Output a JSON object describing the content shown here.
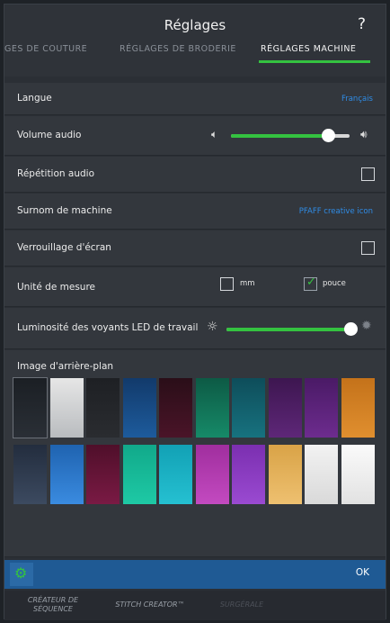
{
  "header": {
    "title": "Réglages",
    "help_icon": "?"
  },
  "tabs": [
    {
      "label": "GES DE COUTURE",
      "active": false
    },
    {
      "label": "RÉGLAGES DE BRODERIE",
      "active": false
    },
    {
      "label": "RÉGLAGES MACHINE",
      "active": true
    }
  ],
  "settings": {
    "language": {
      "label": "Langue",
      "value": "Français"
    },
    "volume": {
      "label": "Volume audio",
      "level": 0.82
    },
    "audio_repeat": {
      "label": "Répétition audio",
      "checked": false
    },
    "nickname": {
      "label": "Surnom de machine",
      "value": "PFAFF creative icon"
    },
    "screen_lock": {
      "label": "Verrouillage d'écran",
      "checked": false
    },
    "units": {
      "label": "Unité de mesure",
      "options": [
        {
          "label": "mm",
          "checked": false
        },
        {
          "label": "pouce",
          "checked": true
        }
      ]
    },
    "led_brightness": {
      "label": "Luminosité des voyants LED de travail",
      "level": 0.96
    },
    "background": {
      "label": "Image d'arrière-plan",
      "selected_index": 0,
      "swatches": [
        {
          "top": "#1b1f24",
          "bottom": "#2a2f36"
        },
        {
          "top": "#e6e6e6",
          "bottom": "#b9bcbf"
        },
        {
          "top": "#1e2024",
          "bottom": "#2a2c30"
        },
        {
          "top": "#123a6b",
          "bottom": "#1d5b9c"
        },
        {
          "top": "#2a0e18",
          "bottom": "#4a1428"
        },
        {
          "top": "#0d5a45",
          "bottom": "#168a68"
        },
        {
          "top": "#0e4d5a",
          "bottom": "#17727f"
        },
        {
          "top": "#3d1650",
          "bottom": "#5e2778"
        },
        {
          "top": "#4a1a66",
          "bottom": "#6d2c8e"
        },
        {
          "top": "#c4721a",
          "bottom": "#e08f2f"
        },
        {
          "top": "#232d3e",
          "bottom": "#3c4a60"
        },
        {
          "top": "#1f63b0",
          "bottom": "#3a8be0"
        },
        {
          "top": "#4f0f2a",
          "bottom": "#7a1a44"
        },
        {
          "top": "#11a98a",
          "bottom": "#1ec9a5"
        },
        {
          "top": "#12a1b5",
          "bottom": "#25c0d1"
        },
        {
          "top": "#a02e9e",
          "bottom": "#c34ac0"
        },
        {
          "top": "#7b2fb0",
          "bottom": "#9a4ad1"
        },
        {
          "top": "#d9a347",
          "bottom": "#eec070"
        },
        {
          "top": "#f2f2f2",
          "bottom": "#d9d9d9"
        },
        {
          "top": "#fafafa",
          "bottom": "#e2e2e2"
        }
      ]
    }
  },
  "actionbar": {
    "ok_label": "OK"
  },
  "bottom_nav": [
    {
      "label": "CRÉATEUR DE SÉQUENCE"
    },
    {
      "label": "STITCH CREATOR™"
    },
    {
      "label": "SURGÉRALE"
    }
  ],
  "colors": {
    "accent": "#34c240",
    "link": "#2f8ce6",
    "bar": "#1f5a94"
  }
}
